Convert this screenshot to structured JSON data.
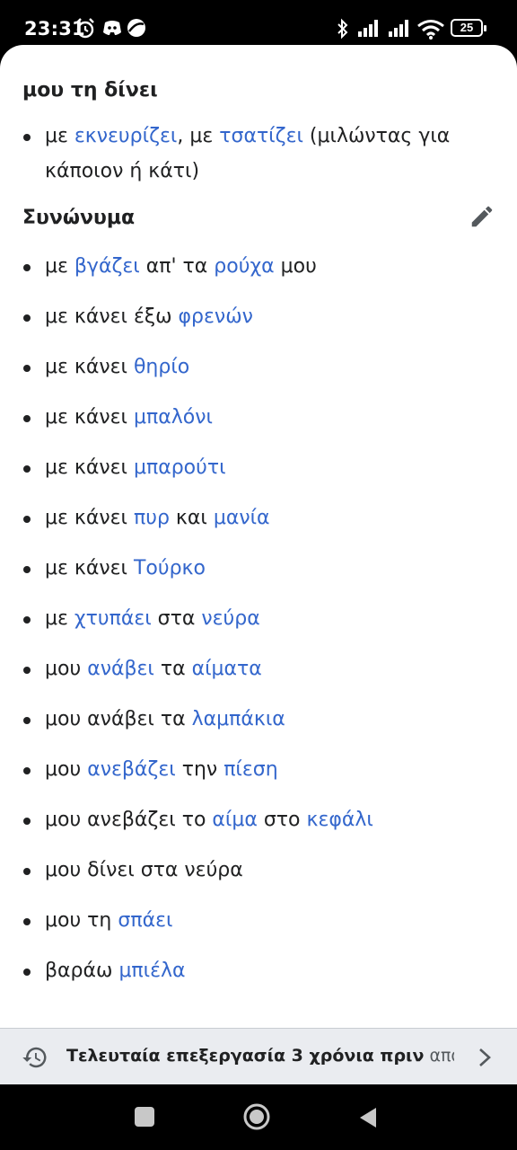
{
  "status": {
    "time": "23:31",
    "battery": "25"
  },
  "section1": {
    "heading": "μου τη δίνει",
    "items": [
      {
        "line1_a": "με ",
        "line1_b": "εκνευρίζει",
        "line1_c": ", με ",
        "line1_d": "τσατίζει",
        "line1_e": " (μιλώντας για",
        "line2": "κάποιον ή κάτι)"
      }
    ]
  },
  "section2": {
    "heading": "Συνώνυμα",
    "items": [
      {
        "parts": [
          {
            "t": "με ",
            "link": false
          },
          {
            "t": "βγάζει",
            "link": true
          },
          {
            "t": " απ' τα ",
            "link": false
          },
          {
            "t": "ρούχα",
            "link": true
          },
          {
            "t": " μου",
            "link": false
          }
        ]
      },
      {
        "parts": [
          {
            "t": "με κάνει έξω ",
            "link": false
          },
          {
            "t": "φρενών",
            "link": true
          }
        ]
      },
      {
        "parts": [
          {
            "t": "με κάνει ",
            "link": false
          },
          {
            "t": "θηρίο",
            "link": true
          }
        ]
      },
      {
        "parts": [
          {
            "t": "με κάνει ",
            "link": false
          },
          {
            "t": "μπαλόνι",
            "link": true
          }
        ]
      },
      {
        "parts": [
          {
            "t": "με κάνει ",
            "link": false
          },
          {
            "t": "μπαρούτι",
            "link": true
          }
        ]
      },
      {
        "parts": [
          {
            "t": "με κάνει ",
            "link": false
          },
          {
            "t": "πυρ",
            "link": true
          },
          {
            "t": " και ",
            "link": false
          },
          {
            "t": "μανία",
            "link": true
          }
        ]
      },
      {
        "parts": [
          {
            "t": "με κάνει ",
            "link": false
          },
          {
            "t": "Τούρκο",
            "link": true
          }
        ]
      },
      {
        "parts": [
          {
            "t": "με ",
            "link": false
          },
          {
            "t": "χτυπάει",
            "link": true
          },
          {
            "t": " στα ",
            "link": false
          },
          {
            "t": "νεύρα",
            "link": true
          }
        ]
      },
      {
        "parts": [
          {
            "t": "μου ",
            "link": false
          },
          {
            "t": "ανάβει",
            "link": true
          },
          {
            "t": " τα ",
            "link": false
          },
          {
            "t": "αίματα",
            "link": true
          }
        ]
      },
      {
        "parts": [
          {
            "t": "μου ανάβει τα ",
            "link": false
          },
          {
            "t": "λαμπάκια",
            "link": true
          }
        ]
      },
      {
        "parts": [
          {
            "t": "μου ",
            "link": false
          },
          {
            "t": "ανεβάζει",
            "link": true
          },
          {
            "t": " την ",
            "link": false
          },
          {
            "t": "πίεση",
            "link": true
          }
        ]
      },
      {
        "parts": [
          {
            "t": "μου ανεβάζει το ",
            "link": false
          },
          {
            "t": "αίμα",
            "link": true
          },
          {
            "t": " στο ",
            "link": false
          },
          {
            "t": "κεφάλι",
            "link": true
          }
        ]
      },
      {
        "parts": [
          {
            "t": "μου δίνει στα νεύρα",
            "link": false
          }
        ]
      },
      {
        "parts": [
          {
            "t": "μου τη ",
            "link": false
          },
          {
            "t": "σπάει",
            "link": true
          }
        ]
      },
      {
        "parts": [
          {
            "t": "βαράω ",
            "link": false
          },
          {
            "t": "μπιέλα",
            "link": true
          }
        ]
      }
    ]
  },
  "footer": {
    "bold": "Τελευταία επεξεργασία 3 χρόνια πριν",
    "rest": " από…"
  },
  "colors": {
    "link": "#3366cc",
    "text": "#202122"
  },
  "icons": {
    "edit": "pencil-icon",
    "history": "history-icon",
    "chevron": "chevron-right-icon"
  }
}
